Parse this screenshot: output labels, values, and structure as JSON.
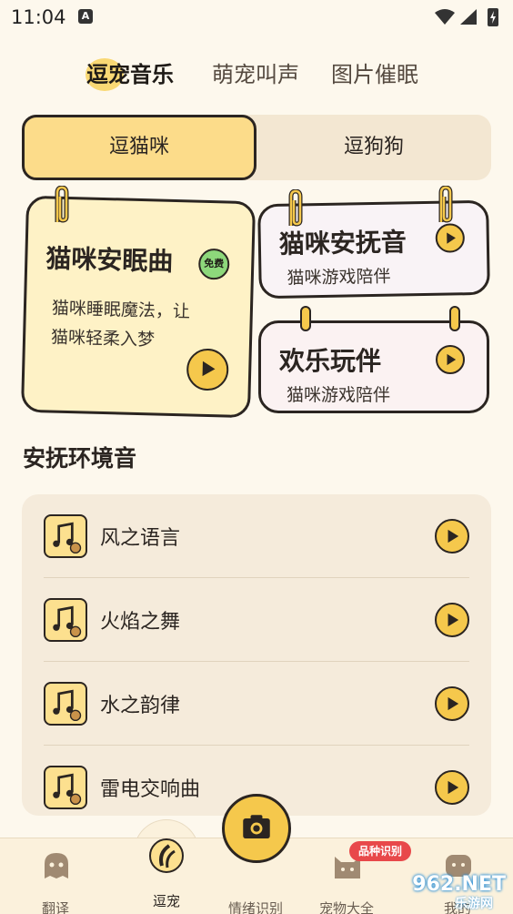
{
  "status_bar": {
    "time": "11:04",
    "notification_letter": "A",
    "icons": [
      "wifi-icon",
      "signal-icon",
      "battery-charging-icon"
    ]
  },
  "top_tabs": [
    {
      "label": "逗宠音乐",
      "active": true
    },
    {
      "label": "萌宠叫声",
      "active": false
    },
    {
      "label": "图片催眠",
      "active": false
    }
  ],
  "segment": {
    "options": [
      "逗猫咪",
      "逗狗狗"
    ],
    "selected": "逗猫咪"
  },
  "cards": {
    "sleep": {
      "title": "猫咪安眠曲",
      "badge": "免费",
      "desc_line1": "猫咪睡眠魔法，让",
      "desc_line2": "猫咪轻柔入梦"
    },
    "soothe": {
      "title": "猫咪安抚音",
      "subtitle": "猫咪游戏陪伴"
    },
    "play": {
      "title": "欢乐玩伴",
      "subtitle": "猫咪游戏陪伴"
    }
  },
  "section": {
    "title": "安抚环境音",
    "items": [
      {
        "label": "风之语言"
      },
      {
        "label": "火焰之舞"
      },
      {
        "label": "水之韵律"
      },
      {
        "label": "雷电交响曲"
      }
    ]
  },
  "bottom_nav": {
    "items": [
      {
        "label": "翻译",
        "icon": "chat-ghost-icon"
      },
      {
        "label": "逗宠",
        "icon": "music-note-icon",
        "active": true
      },
      {
        "label": "情绪识别",
        "icon": "camera-icon"
      },
      {
        "label": "宠物大全",
        "icon": "cat-face-icon"
      },
      {
        "label": "我的",
        "icon": "profile-icon"
      }
    ],
    "badge": "品种识别"
  },
  "watermark": {
    "text": "962.NET",
    "sub": "乐游网"
  },
  "colors": {
    "background": "#FDF8ED",
    "accent_yellow": "#F5C84C",
    "segment_active": "#FCDC8A",
    "badge_green": "#8DD87B",
    "badge_red": "#E8484A",
    "outline": "#2B2521"
  }
}
